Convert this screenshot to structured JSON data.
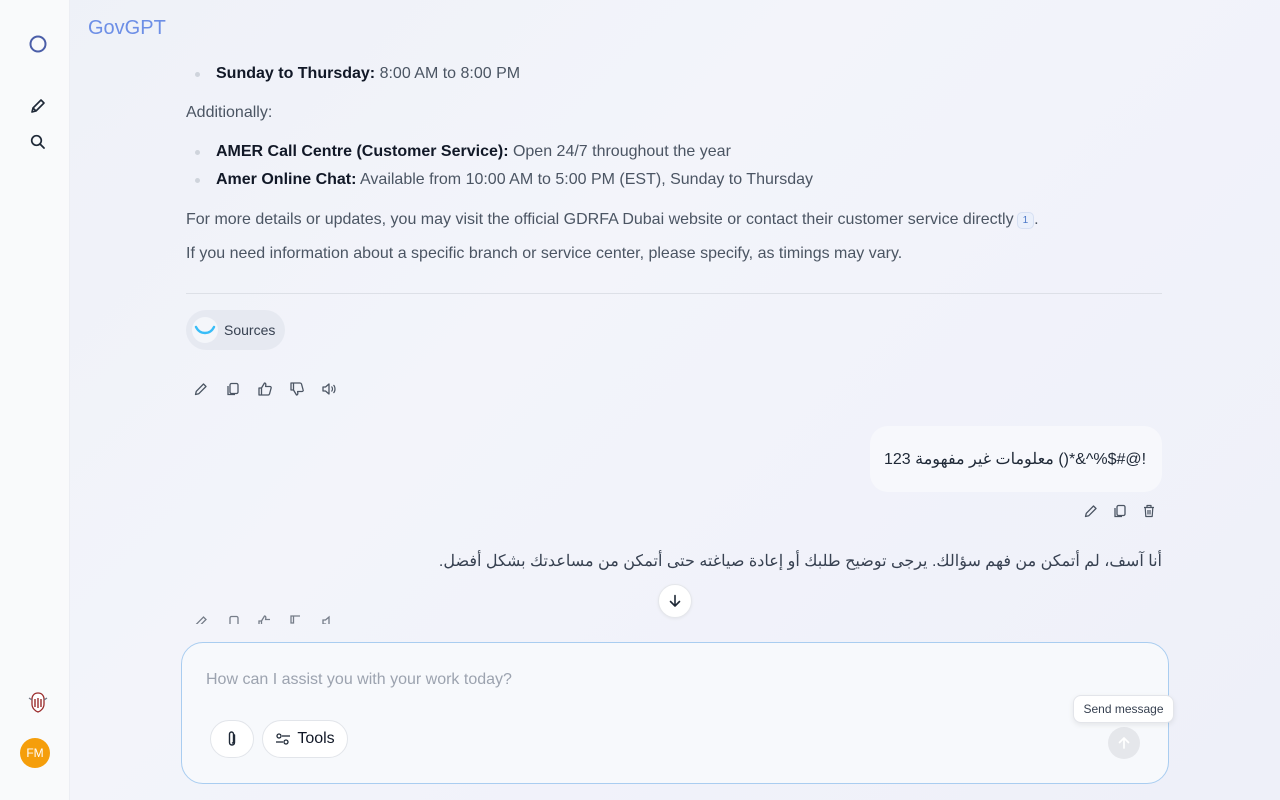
{
  "app": {
    "brand": "GovGPT"
  },
  "sidebar": {
    "icons": [
      "circle-logo-icon",
      "new-chat-pencil-icon",
      "search-icon",
      "emblem-icon"
    ],
    "avatar_initials": "FM"
  },
  "assistant_message": {
    "hours": [
      {
        "label": "Sunday to Thursday:",
        "text": " 8:00 AM to 8:00 PM"
      }
    ],
    "additionally": "Additionally:",
    "extras": [
      {
        "label": "AMER Call Centre (Customer Service):",
        "text": " Open 24/7 throughout the year"
      },
      {
        "label": "Amer Online Chat:",
        "text": " Available from 10:00 AM to 5:00 PM (EST), Sunday to Thursday"
      }
    ],
    "details": "For more details or updates, you may visit the official GDRFA Dubai website or contact their customer service directly",
    "citation": "1",
    "details_end": ".",
    "branch_note": "If you need information about a specific branch or service center, please specify, as timings may vary.",
    "sources_label": "Sources"
  },
  "user_message": {
    "text": "!@#$%^&*() معلومات غير مفهومة 123"
  },
  "assistant_reply": {
    "text": "أنا آسف، لم أتمكن من فهم سؤالك. يرجى توضيح طلبك أو إعادة صياغته حتى أتمكن من مساعدتك بشكل أفضل."
  },
  "composer": {
    "placeholder": "How can I assist you with your work today?",
    "tools_label": "Tools",
    "send_tooltip": "Send message"
  },
  "colors": {
    "brand": "#6d8fe6",
    "avatar": "#f59e0b",
    "composer_border": "#a9cdf0"
  }
}
